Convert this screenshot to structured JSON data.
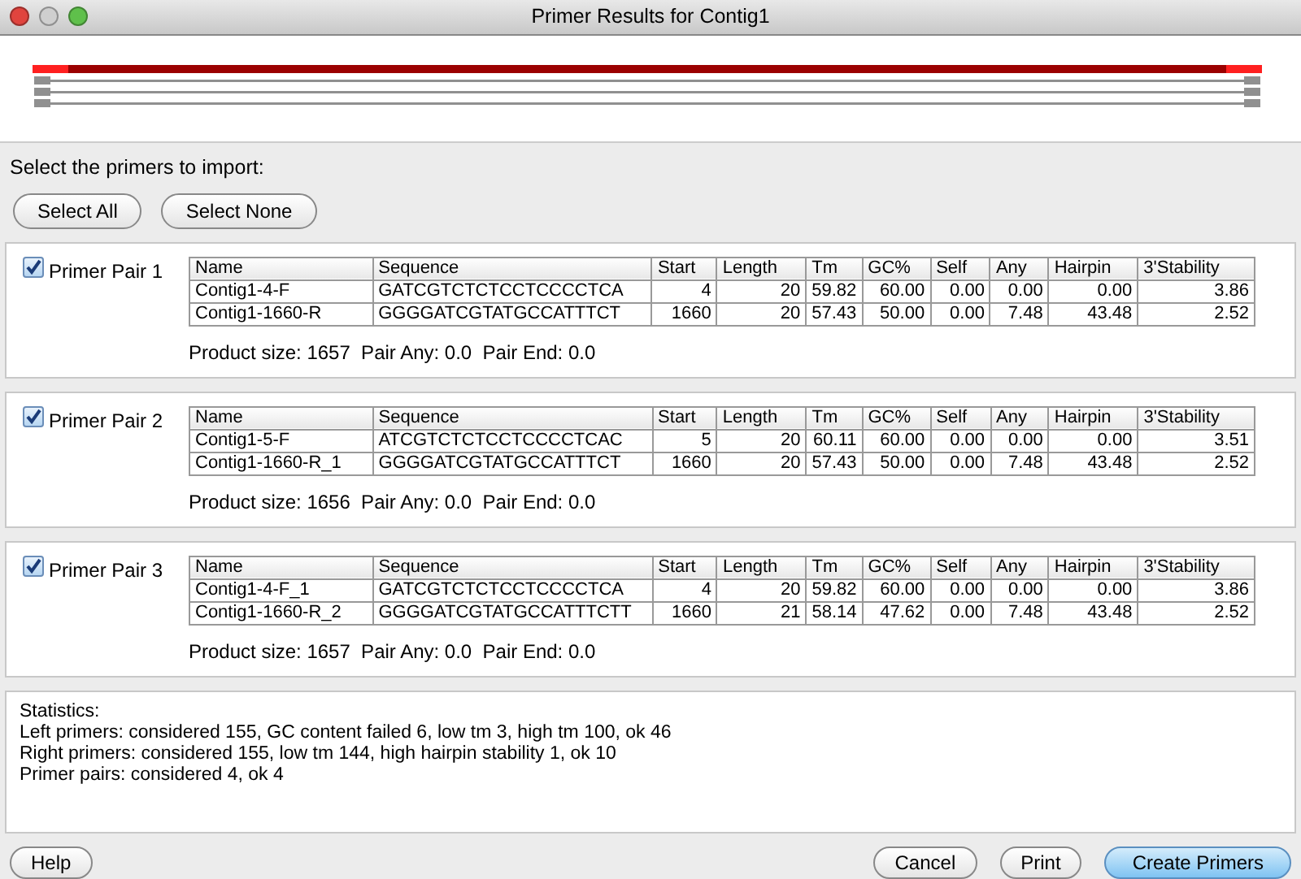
{
  "window": {
    "title": "Primer Results for Contig1"
  },
  "instruction": "Select the primers to import:",
  "select_buttons": [
    "Select All",
    "Select None"
  ],
  "pairs": [
    {
      "label": "Primer Pair 1",
      "checked": true,
      "columns": [
        "Name",
        "Sequence",
        "Start",
        "Length",
        "Tm",
        "GC%",
        "Self",
        "Any",
        "Hairpin",
        "3'Stability"
      ],
      "rows": [
        [
          "Contig1-4-F",
          "GATCGTCTCTCCTCCCCTCA",
          "4",
          "20",
          "59.82",
          "60.00",
          "0.00",
          "0.00",
          "0.00",
          "3.86"
        ],
        [
          "Contig1-1660-R",
          "GGGGATCGTATGCCATTTCT",
          "1660",
          "20",
          "57.43",
          "50.00",
          "0.00",
          "7.48",
          "43.48",
          "2.52"
        ]
      ],
      "summary": "Product size: 1657  Pair Any: 0.0  Pair End: 0.0"
    },
    {
      "label": "Primer Pair 2",
      "checked": true,
      "columns": [
        "Name",
        "Sequence",
        "Start",
        "Length",
        "Tm",
        "GC%",
        "Self",
        "Any",
        "Hairpin",
        "3'Stability"
      ],
      "rows": [
        [
          "Contig1-5-F",
          "ATCGTCTCTCCTCCCCTCAC",
          "5",
          "20",
          "60.11",
          "60.00",
          "0.00",
          "0.00",
          "0.00",
          "3.51"
        ],
        [
          "Contig1-1660-R_1",
          "GGGGATCGTATGCCATTTCT",
          "1660",
          "20",
          "57.43",
          "50.00",
          "0.00",
          "7.48",
          "43.48",
          "2.52"
        ]
      ],
      "summary": "Product size: 1656  Pair Any: 0.0  Pair End: 0.0"
    },
    {
      "label": "Primer Pair 3",
      "checked": true,
      "columns": [
        "Name",
        "Sequence",
        "Start",
        "Length",
        "Tm",
        "GC%",
        "Self",
        "Any",
        "Hairpin",
        "3'Stability"
      ],
      "rows": [
        [
          "Contig1-4-F_1",
          "GATCGTCTCTCCTCCCCTCA",
          "4",
          "20",
          "59.82",
          "60.00",
          "0.00",
          "0.00",
          "0.00",
          "3.86"
        ],
        [
          "Contig1-1660-R_2",
          "GGGGATCGTATGCCATTTCTT",
          "1660",
          "21",
          "58.14",
          "47.62",
          "0.00",
          "7.48",
          "43.48",
          "2.52"
        ]
      ],
      "summary": "Product size: 1657  Pair Any: 0.0  Pair End: 0.0"
    }
  ],
  "statistics": [
    "Statistics:",
    "Left primers: considered 155, GC content failed 6, low tm 3, high tm 100, ok 46",
    "Right primers: considered 155, low tm 144, high hairpin stability 1, ok 10",
    "Primer pairs: considered 4, ok 4"
  ],
  "footer_buttons": [
    {
      "label": "Help",
      "kind": "plain"
    },
    {
      "label": "Cancel",
      "kind": "plain"
    },
    {
      "label": "Print",
      "kind": "plain"
    },
    {
      "label": "Create Primers",
      "kind": "default"
    }
  ]
}
